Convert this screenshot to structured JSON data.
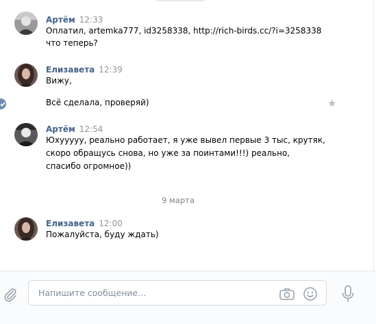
{
  "messages": [
    {
      "author": "Артём",
      "time": "12:33",
      "lines": [
        "Оплатил, artemka777, id3258338, http://rich-birds.cc/?i=3258338",
        "что теперь?"
      ]
    },
    {
      "author": "Елизавета",
      "time": "12:39",
      "lines": [
        "Вижу,",
        "Всё сделала, проверяй)"
      ]
    },
    {
      "author": "Артём",
      "time": "12:54",
      "lines": [
        "Юхууууу, реально работает, я уже вывел первые 3 тыс, крутяк,",
        "скоро обращусь снова, но уже за поинтами!!!) реально,",
        "спасибо огромное))"
      ]
    },
    {
      "author": "Елизавета",
      "time": "12:00",
      "lines": [
        "Пожалуйста, буду ждать)"
      ]
    }
  ],
  "date_separator": "9 марта",
  "composer": {
    "placeholder": "Напишите сообщение...",
    "value": ""
  },
  "icons": {
    "attach": "paperclip-icon",
    "camera": "camera-icon",
    "emoji": "smile-icon",
    "voice": "microphone-icon",
    "favorite": "star-icon",
    "read": "check-icon"
  },
  "colors": {
    "author": "#42648b",
    "time": "#939393",
    "accent": "#6f8db3",
    "icon": "#99a2ad"
  }
}
